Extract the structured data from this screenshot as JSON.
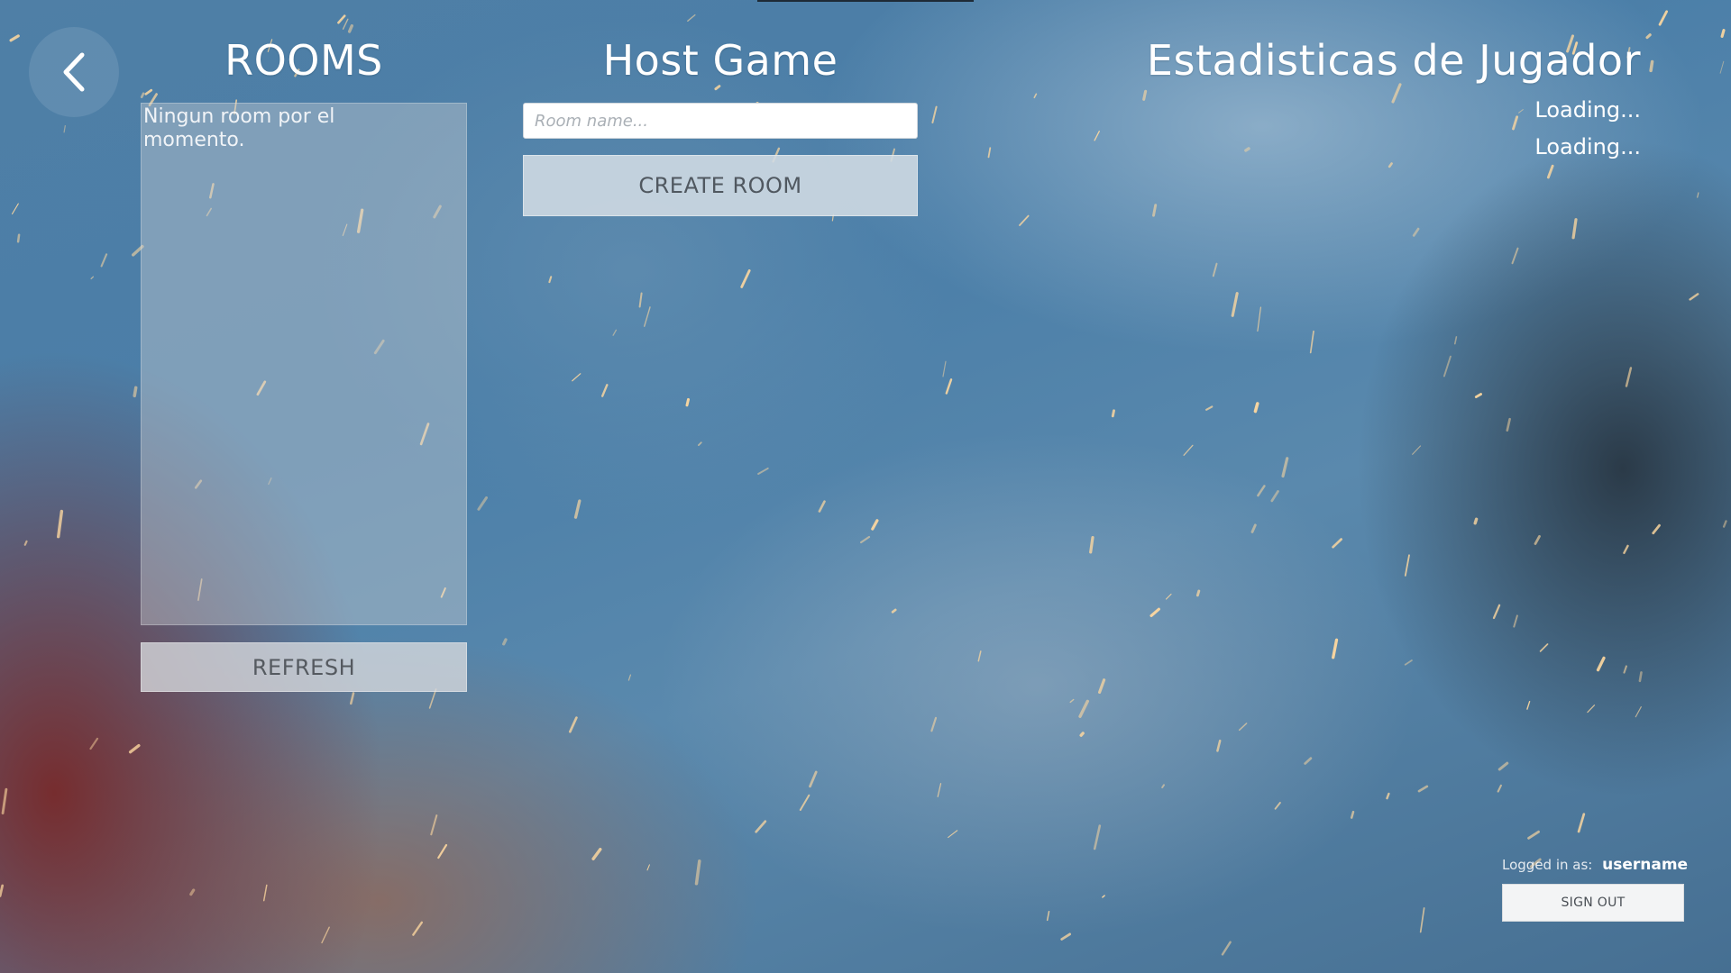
{
  "nav": {
    "back_icon": "chevron-left-icon"
  },
  "rooms": {
    "title": "ROOMS",
    "empty_message": "Ningun room por el momento.",
    "refresh_label": "REFRESH"
  },
  "host": {
    "title": "Host Game",
    "room_name_placeholder": "Room name...",
    "room_name_value": "",
    "create_label": "CREATE ROOM"
  },
  "stats": {
    "title": "Estadisticas  de Jugador",
    "values": [
      "Loading...",
      "Loading..."
    ]
  },
  "account": {
    "logged_in_label": "Logged in as:",
    "username": "username",
    "sign_out_label": "SIGN OUT"
  },
  "colors": {
    "background": "#4a7ea8",
    "spark": "#ffd9a0",
    "panel": "#c8cdd2"
  }
}
